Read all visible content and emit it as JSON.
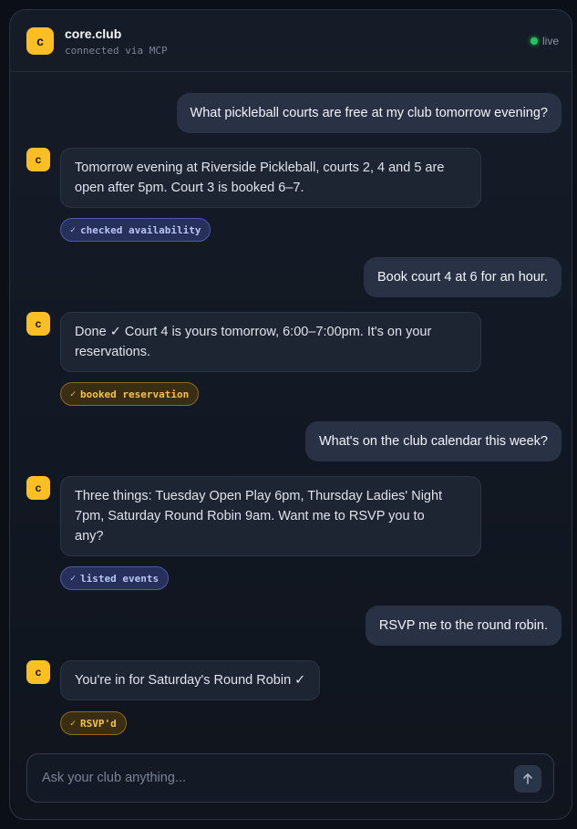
{
  "header": {
    "logo_letter": "c",
    "title": "core.club",
    "subtitle": "connected via MCP",
    "status": "live",
    "status_color": "#22c55e"
  },
  "messages": [
    {
      "role": "user",
      "text": "What pickleball courts are free at my club tomorrow evening?"
    },
    {
      "role": "assistant",
      "avatar": "c",
      "lines": [
        "Tomorrow evening at Riverside Pickleball, courts 2, 4 and 5 are",
        "open after 5pm. Court 3 is booked 6–7."
      ],
      "tool": {
        "label": "checked availability",
        "color": "blue"
      }
    },
    {
      "role": "user",
      "text": "Book court 4 at 6 for an hour."
    },
    {
      "role": "assistant",
      "avatar": "c",
      "lines": [
        "Done ✓ Court 4 is yours tomorrow, 6:00–7:00pm. It's on your",
        "reservations."
      ],
      "tool": {
        "label": "booked reservation",
        "color": "amber"
      }
    },
    {
      "role": "user",
      "text": "What's on the club calendar this week?"
    },
    {
      "role": "assistant",
      "avatar": "c",
      "lines": [
        "Three things: Tuesday Open Play 6pm, Thursday Ladies' Night",
        "7pm, Saturday Round Robin 9am. Want me to RSVP you to",
        "any?"
      ],
      "tool": {
        "label": "listed events",
        "color": "blue"
      }
    },
    {
      "role": "user",
      "text": "RSVP me to the round robin."
    },
    {
      "role": "assistant",
      "avatar": "c",
      "lines": [
        "You're in for Saturday's Round Robin ✓"
      ],
      "tool": {
        "label": "RSVP'd",
        "color": "amber"
      }
    }
  ],
  "tool_check": "✓",
  "composer": {
    "placeholder": "Ask your club anything...",
    "send_icon": "arrow-up-icon"
  },
  "colors": {
    "accent": "#fbbf24",
    "tool_blue": "#b9c3f5",
    "tool_amber": "#f6c14a"
  }
}
